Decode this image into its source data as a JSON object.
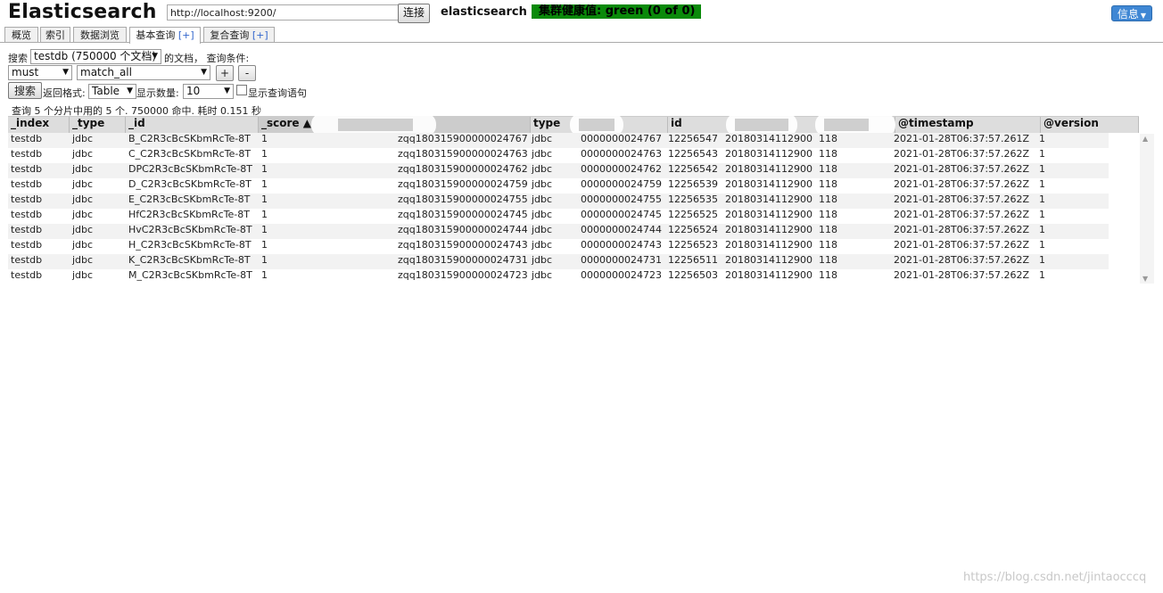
{
  "header": {
    "brand": "Elasticsearch",
    "url": "http://localhost:9200/",
    "connect_label": "连接",
    "cluster_name": "elasticsearch",
    "health": "集群健康值: green (0 of 0)",
    "info_label": "信息"
  },
  "tabs": [
    {
      "label": "概览"
    },
    {
      "label": "索引"
    },
    {
      "label": "数据浏览"
    },
    {
      "label": "基本查询",
      "plus": "[+]"
    },
    {
      "label": "复合查询",
      "plus": "[+]"
    }
  ],
  "query": {
    "search_label": "搜索",
    "index_select": "testdb (750000 个文档)",
    "docs_label": "的文档，  查询条件:",
    "bool_select": "must",
    "clause_select": "match_all",
    "add_label": "+",
    "remove_label": "-",
    "search_button": "搜索",
    "format_label": "返回格式:",
    "format_select": "Table",
    "size_label": "显示数量:",
    "size_select": "10",
    "show_query_label": "显示查询语句",
    "summary": "查询 5 个分片中用的 5 个. 750000 命中. 耗时 0.151 秒"
  },
  "table": {
    "headers": [
      "_index",
      "_type",
      "_id",
      "_score ▲",
      "type",
      "id",
      "@timestamp",
      "@version"
    ],
    "rows": [
      [
        "testdb",
        "jdbc",
        "B_C2R3cBcSKbmRcTe-8T",
        "1",
        "zqq180315900000024767",
        "jdbc",
        "0000000024767",
        "12256547",
        "20180314112900",
        "118",
        "2021-01-28T06:37:57.261Z",
        "1"
      ],
      [
        "testdb",
        "jdbc",
        "C_C2R3cBcSKbmRcTe-8T",
        "1",
        "zqq180315900000024763",
        "jdbc",
        "0000000024763",
        "12256543",
        "20180314112900",
        "118",
        "2021-01-28T06:37:57.262Z",
        "1"
      ],
      [
        "testdb",
        "jdbc",
        "DPC2R3cBcSKbmRcTe-8T",
        "1",
        "zqq180315900000024762",
        "jdbc",
        "0000000024762",
        "12256542",
        "20180314112900",
        "118",
        "2021-01-28T06:37:57.262Z",
        "1"
      ],
      [
        "testdb",
        "jdbc",
        "D_C2R3cBcSKbmRcTe-8T",
        "1",
        "zqq180315900000024759",
        "jdbc",
        "0000000024759",
        "12256539",
        "20180314112900",
        "118",
        "2021-01-28T06:37:57.262Z",
        "1"
      ],
      [
        "testdb",
        "jdbc",
        "E_C2R3cBcSKbmRcTe-8T",
        "1",
        "zqq180315900000024755",
        "jdbc",
        "0000000024755",
        "12256535",
        "20180314112900",
        "118",
        "2021-01-28T06:37:57.262Z",
        "1"
      ],
      [
        "testdb",
        "jdbc",
        "HfC2R3cBcSKbmRcTe-8T",
        "1",
        "zqq180315900000024745",
        "jdbc",
        "0000000024745",
        "12256525",
        "20180314112900",
        "118",
        "2021-01-28T06:37:57.262Z",
        "1"
      ],
      [
        "testdb",
        "jdbc",
        "HvC2R3cBcSKbmRcTe-8T",
        "1",
        "zqq180315900000024744",
        "jdbc",
        "0000000024744",
        "12256524",
        "20180314112900",
        "118",
        "2021-01-28T06:37:57.262Z",
        "1"
      ],
      [
        "testdb",
        "jdbc",
        "H_C2R3cBcSKbmRcTe-8T",
        "1",
        "zqq180315900000024743",
        "jdbc",
        "0000000024743",
        "12256523",
        "20180314112900",
        "118",
        "2021-01-28T06:37:57.262Z",
        "1"
      ],
      [
        "testdb",
        "jdbc",
        "K_C2R3cBcSKbmRcTe-8T",
        "1",
        "zqq180315900000024731",
        "jdbc",
        "0000000024731",
        "12256511",
        "20180314112900",
        "118",
        "2021-01-28T06:37:57.262Z",
        "1"
      ],
      [
        "testdb",
        "jdbc",
        "M_C2R3cBcSKbmRcTe-8T",
        "1",
        "zqq180315900000024723",
        "jdbc",
        "0000000024723",
        "12256503",
        "20180314112900",
        "118",
        "2021-01-28T06:37:57.262Z",
        "1"
      ]
    ]
  },
  "watermark": "https://blog.csdn.net/jintaocccq",
  "colors": {
    "health_green": "#0a8a0a",
    "info_blue": "#3f87d4",
    "link_blue": "#3366cc"
  }
}
